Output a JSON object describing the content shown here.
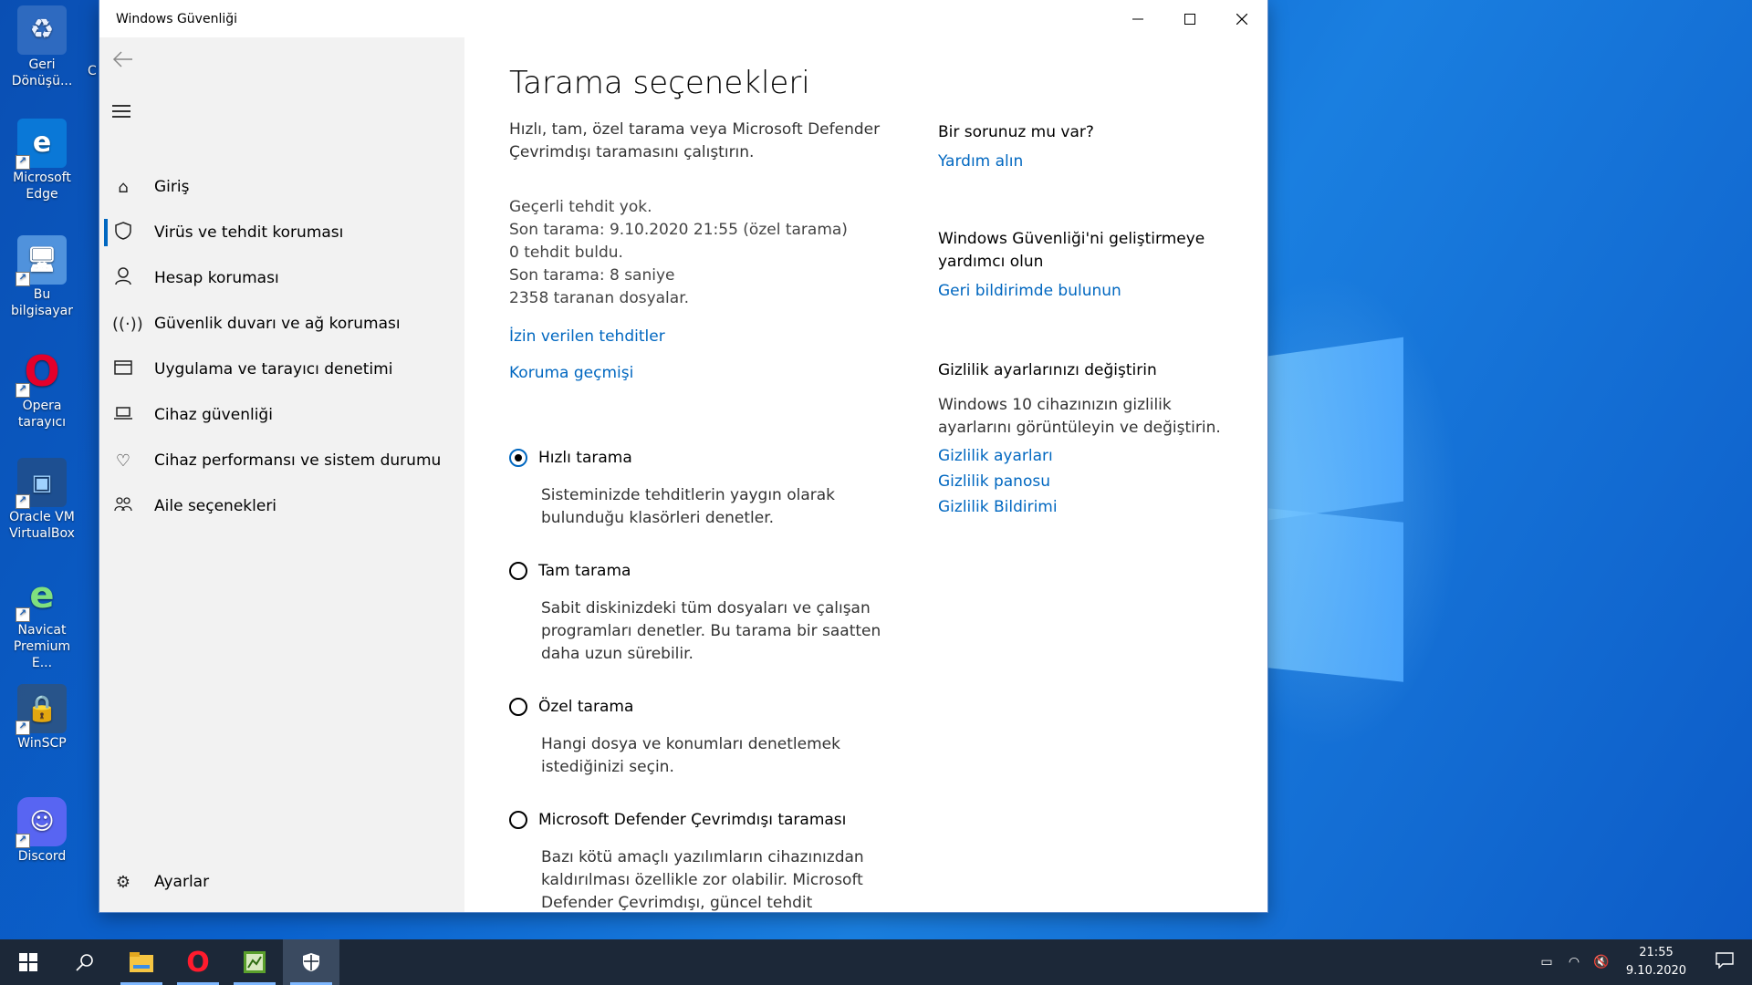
{
  "window": {
    "title": "Windows Güvenliği",
    "controls": {
      "minimize": "—",
      "maximize": "☐",
      "close": "✕"
    }
  },
  "sidebar": {
    "items": [
      {
        "label": "Giriş",
        "icon": "home-icon"
      },
      {
        "label": "Virüs ve tehdit koruması",
        "icon": "shield-icon",
        "active": true
      },
      {
        "label": "Hesap koruması",
        "icon": "person-icon"
      },
      {
        "label": "Güvenlik duvarı ve ağ koruması",
        "icon": "wireless-icon"
      },
      {
        "label": "Uygulama ve tarayıcı denetimi",
        "icon": "app-browser-icon"
      },
      {
        "label": "Cihaz güvenliği",
        "icon": "laptop-icon"
      },
      {
        "label": "Cihaz performansı ve sistem durumu",
        "icon": "heart-icon"
      },
      {
        "label": "Aile seçenekleri",
        "icon": "family-icon"
      }
    ],
    "settings_label": "Ayarlar"
  },
  "main": {
    "title": "Tarama seçenekleri",
    "lead": "Hızlı, tam, özel tarama veya Microsoft Defender Çevrimdışı taramasını çalıştırın.",
    "status_lines": [
      "Geçerli tehdit yok.",
      "Son tarama: 9.10.2020 21:55 (özel tarama)",
      "0 tehdit buldu.",
      "Son tarama: 8 saniye",
      "2358 taranan dosyalar."
    ],
    "links": {
      "allowed_threats": "İzin verilen tehditler",
      "protection_history": "Koruma geçmişi"
    },
    "scan_options": [
      {
        "label": "Hızlı tarama",
        "desc": "Sisteminizde tehditlerin yaygın olarak bulunduğu klasörleri denetler.",
        "checked": true
      },
      {
        "label": "Tam tarama",
        "desc": "Sabit diskinizdeki tüm dosyaları ve çalışan programları denetler. Bu tarama bir saatten daha uzun sürebilir.",
        "checked": false
      },
      {
        "label": "Özel tarama",
        "desc": "Hangi dosya ve konumları denetlemek istediğinizi seçin.",
        "checked": false
      },
      {
        "label": "Microsoft Defender Çevrimdışı taraması",
        "desc": "Bazı kötü amaçlı yazılımların cihazınızdan kaldırılması özellikle zor olabilir. Microsoft Defender Çevrimdışı, güncel tehdit",
        "checked": false
      }
    ]
  },
  "right": {
    "help_heading": "Bir sorunuz mu var?",
    "help_link": "Yardım alın",
    "improve_heading": "Windows Güvenliği'ni geliştirmeye yardımcı olun",
    "improve_link": "Geri bildirimde bulunun",
    "privacy_heading": "Gizlilik ayarlarınızı değiştirin",
    "privacy_text": "Windows 10 cihazınızın gizlilik ayarlarını görüntüleyin ve değiştirin.",
    "privacy_links": [
      "Gizlilik ayarları",
      "Gizlilik panosu",
      "Gizlilik Bildirimi"
    ]
  },
  "desktop": {
    "icons": [
      {
        "label": "Geri Dönüşü...",
        "icon": "recycle-bin-icon"
      },
      {
        "label": "Microsoft Edge",
        "icon": "edge-icon"
      },
      {
        "label": "Bu bilgisayar",
        "icon": "computer-icon"
      },
      {
        "label": "Opera tarayıcı",
        "icon": "opera-icon"
      },
      {
        "label": "Oracle VM VirtualBox",
        "icon": "virtualbox-icon"
      },
      {
        "label": "Navicat Premium E...",
        "icon": "navicat-icon"
      },
      {
        "label": "WinSCP",
        "icon": "winscp-icon"
      },
      {
        "label": "Discord",
        "icon": "discord-icon"
      }
    ],
    "partial_label": "C"
  },
  "taskbar": {
    "apps": [
      "start-icon",
      "search-icon",
      "file-explorer-icon",
      "opera-icon",
      "app-icon",
      "windows-security-icon"
    ],
    "clock_time": "21:55",
    "clock_date": "9.10.2020"
  },
  "colors": {
    "accent": "#0067c0",
    "sidebar_bg": "#f2f2f2",
    "taskbar_bg": "#1c2838"
  }
}
